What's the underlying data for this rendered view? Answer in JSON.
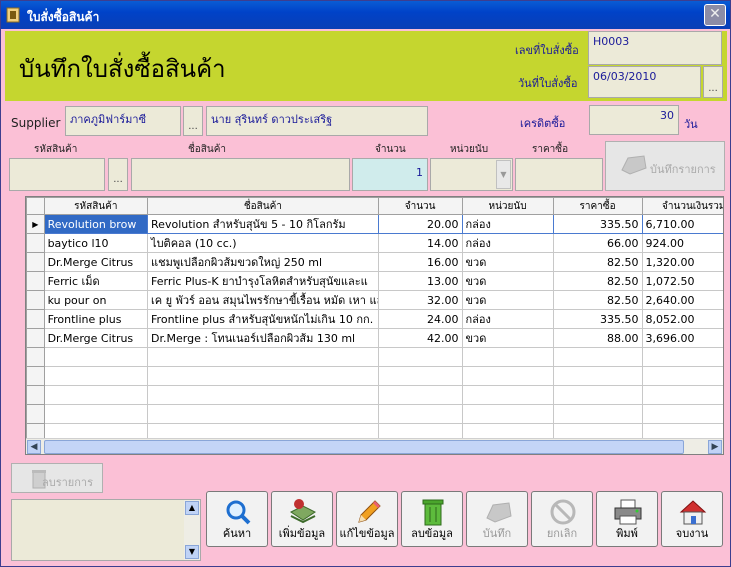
{
  "window": {
    "title": "ใบสั่งซื้อสินค้า",
    "close_symbol": "✕"
  },
  "header": {
    "heading": "บันทึกใบสั่งซื้อสินค้า",
    "order_no_label": "เลขที่ใบสั่งซื้อ",
    "order_no": "H0003",
    "order_date_label": "วันที่ใบสั่งซื้อ",
    "order_date": "06/03/2010",
    "date_button": "..."
  },
  "supplier": {
    "label": "Supplier",
    "name": "ภาคภูมิฟาร์มาซี",
    "lookup": "...",
    "contact": "นาย สุรินทร์ ดาวประเสริฐ",
    "credit_label": "เครดิตซื้อ",
    "credit_days": "30",
    "credit_unit": "วัน"
  },
  "entry": {
    "code_label": "รหัสสินค้า",
    "code_value": "",
    "code_lookup": "...",
    "name_label": "ชื่อสินค้า",
    "name_value": "",
    "qty_label": "จำนวน",
    "qty_value": "1",
    "unit_label": "หน่วยนับ",
    "unit_value": "",
    "price_label": "ราคาซื้อ",
    "price_value": "",
    "save_item_label": "บันทึกรายการ"
  },
  "table": {
    "columns": [
      "รหัสสินค้า",
      "ชื่อสินค้า",
      "จำนวน",
      "หน่วยนับ",
      "ราคาซื้อ",
      "จำนวนเงินรวม"
    ],
    "rows": [
      [
        "Revolution brow",
        "Revolution สำหรับสุนัข 5 - 10 กิโลกรัม",
        "20.00",
        "กล่อง",
        "335.50",
        "6,710.00"
      ],
      [
        "baytico l10",
        "ไบติคอล (10 cc.)",
        "14.00",
        "กล่อง",
        "66.00",
        "924.00"
      ],
      [
        "Dr.Merge Citrus",
        "แชมพูเปลือกผิวส้มขวดใหญ่ 250 ml",
        "16.00",
        "ขวด",
        "82.50",
        "1,320.00"
      ],
      [
        "Ferric เม็ด",
        "Ferric Plus-K ยาบำรุงโลหิตสำหรับสุนัขและแ",
        "13.00",
        "ขวด",
        "82.50",
        "1,072.50"
      ],
      [
        "ku pour on",
        "เค ยู พัวร์ ออน สมุนไพรรักษาขี้เรื้อน หมัด เหา และ",
        "32.00",
        "ขวด",
        "82.50",
        "2,640.00"
      ],
      [
        "Frontline plus",
        "Frontline plus สำหรับสุนัขหนักไม่เกิน 10 กก.",
        "24.00",
        "กล่อง",
        "335.50",
        "8,052.00"
      ],
      [
        "Dr.Merge Citrus",
        "Dr.Merge : โทนเนอร์เปลือกผิวส้ม 130 ml",
        "42.00",
        "ขวด",
        "88.00",
        "3,696.00"
      ]
    ],
    "current_row_marker": "▶"
  },
  "delete_item_label": "ลบรายการ",
  "toolbar": {
    "search": "ค้นหา",
    "add": "เพิ่มข้อมูล",
    "edit": "แก้ไขข้อมูล",
    "delete": "ลบข้อมูล",
    "save": "บันทึก",
    "cancel": "ยกเลิก",
    "print": "พิมพ์",
    "exit": "จบงาน"
  },
  "colors": {
    "background": "#fbc0d6",
    "header": "#c5d62f",
    "field_text": "#1a1a99"
  }
}
